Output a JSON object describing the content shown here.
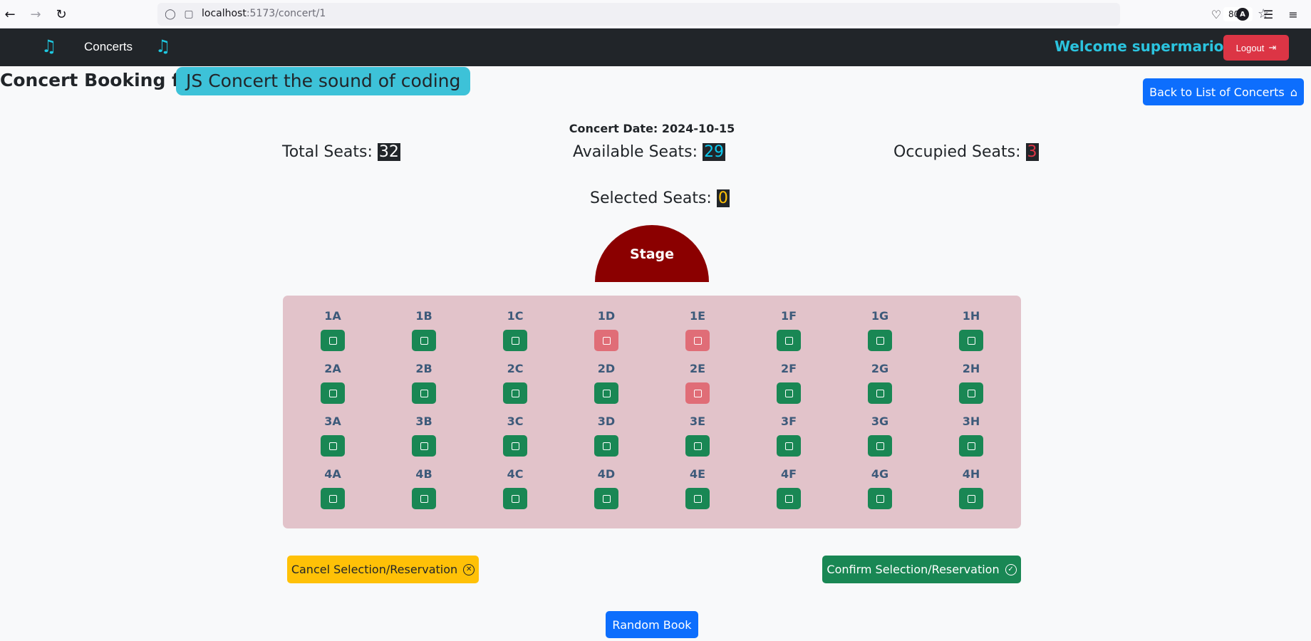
{
  "browser": {
    "url_host": "localhost",
    "url_path": ":5173/concert/1",
    "zoom": "80%",
    "account_initial": "A"
  },
  "navbar": {
    "concerts_link": "Concerts",
    "welcome": "Welcome supermario",
    "logout_label": "Logout"
  },
  "header": {
    "title": "Concert Booking for:",
    "concert_name": "JS Concert the sound of coding",
    "back_button": "Back to List of Concerts"
  },
  "stats": {
    "date_label": "Concert Date: 2024-10-15",
    "total_label": "Total Seats:",
    "total_value": "32",
    "available_label": "Available Seats:",
    "available_value": "29",
    "occupied_label": "Occupied Seats:",
    "occupied_value": "3",
    "selected_label": "Selected Seats:",
    "selected_value": "0"
  },
  "stage_label": "Stage",
  "seats": [
    {
      "id": "1A",
      "status": "available"
    },
    {
      "id": "1B",
      "status": "available"
    },
    {
      "id": "1C",
      "status": "available"
    },
    {
      "id": "1D",
      "status": "occupied"
    },
    {
      "id": "1E",
      "status": "occupied"
    },
    {
      "id": "1F",
      "status": "available"
    },
    {
      "id": "1G",
      "status": "available"
    },
    {
      "id": "1H",
      "status": "available"
    },
    {
      "id": "2A",
      "status": "available"
    },
    {
      "id": "2B",
      "status": "available"
    },
    {
      "id": "2C",
      "status": "available"
    },
    {
      "id": "2D",
      "status": "available"
    },
    {
      "id": "2E",
      "status": "occupied"
    },
    {
      "id": "2F",
      "status": "available"
    },
    {
      "id": "2G",
      "status": "available"
    },
    {
      "id": "2H",
      "status": "available"
    },
    {
      "id": "3A",
      "status": "available"
    },
    {
      "id": "3B",
      "status": "available"
    },
    {
      "id": "3C",
      "status": "available"
    },
    {
      "id": "3D",
      "status": "available"
    },
    {
      "id": "3E",
      "status": "available"
    },
    {
      "id": "3F",
      "status": "available"
    },
    {
      "id": "3G",
      "status": "available"
    },
    {
      "id": "3H",
      "status": "available"
    },
    {
      "id": "4A",
      "status": "available"
    },
    {
      "id": "4B",
      "status": "available"
    },
    {
      "id": "4C",
      "status": "available"
    },
    {
      "id": "4D",
      "status": "available"
    },
    {
      "id": "4E",
      "status": "available"
    },
    {
      "id": "4F",
      "status": "available"
    },
    {
      "id": "4G",
      "status": "available"
    },
    {
      "id": "4H",
      "status": "available"
    }
  ],
  "actions": {
    "cancel": "Cancel Selection/Reservation",
    "confirm": "Confirm Selection/Reservation",
    "random": "Random Book"
  },
  "colors": {
    "navbar_bg": "#212529",
    "accent_cyan": "#2bc3de",
    "available_seat": "#198754",
    "occupied_seat": "#e06d77",
    "stage": "#8b0000",
    "seat_map_bg": "#e2c3ca",
    "primary": "#0d6efd",
    "danger": "#dc3545",
    "warning": "#ffc107"
  }
}
